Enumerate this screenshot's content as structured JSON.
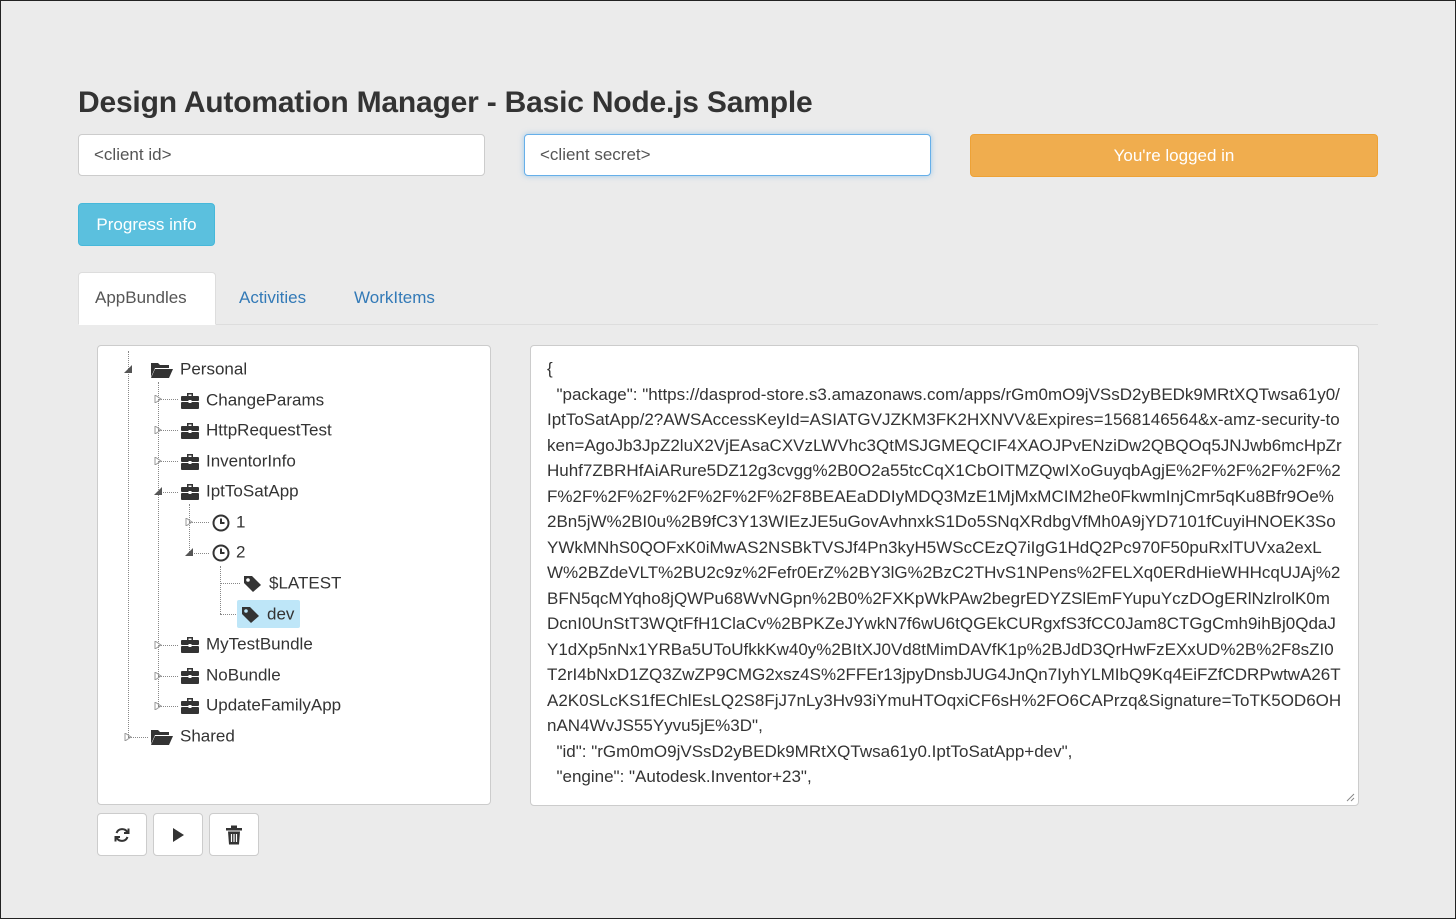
{
  "header": {
    "title": "Design Automation Manager - Basic Node.js Sample"
  },
  "login": {
    "client_id_value": "<client id>",
    "client_secret_value": "<client secret>",
    "status_button_label": "You're logged in"
  },
  "progress_button_label": "Progress info",
  "tabs": [
    {
      "label": "AppBundles",
      "active": true
    },
    {
      "label": "Activities",
      "active": false
    },
    {
      "label": "WorkItems",
      "active": false
    }
  ],
  "tree": {
    "personal": "Personal",
    "items": [
      "ChangeParams",
      "HttpRequestTest",
      "InventorInfo",
      "IptToSatApp",
      "MyTestBundle",
      "NoBundle",
      "UpdateFamilyApp"
    ],
    "versions": [
      "1",
      "2"
    ],
    "aliases": [
      "$LATEST",
      "dev"
    ],
    "shared": "Shared",
    "selected": "dev"
  },
  "details_json": "{\n  \"package\": \"https://dasprod-store.s3.amazonaws.com/apps/rGm0mO9jVSsD2yBEDk9MRtXQTwsa61y0/IptToSatApp/2?AWSAccessKeyId=ASIATGVJZKM3FK2HXNVV&Expires=1568146564&x-amz-security-token=AgoJb3JpZ2luX2VjEAsaCXVzLWVhc3QtMSJGMEQCIF4XAOJPvENziDw2QBQOq5JNJwb6mcHpZrHuhf7ZBRHfAiARure5DZ12g3cvgg%2B0O2a55tcCqX1CbOITMZQwIXoGuyqbAgjE%2F%2F%2F%2F%2F%2F%2F%2F%2F%2F%2F%2F8BEAEaDDIyMDQ3MzE1MjMxMCIM2he0FkwmInjCmr5qKu8Bfr9Oe%2Bn5jW%2BI0u%2B9fC3Y13WIEzJE5uGovAvhnxkS1Do5SNqXRdbgVfMh0A9jYD7101fCuyiHNOEK3SoYWkMNhS0QOFxK0iMwAS2NSBkTVSJf4Pn3kyH5WScCEzQ7iIgG1HdQ2Pc970F50puRxlTUVxa2exLW%2BZdeVLT%2BU2c9z%2Fefr0ErZ%2BY3lG%2BzC2THvS1NPens%2FELXq0ERdHieWHHcqUJAj%2BFN5qcMYqho8jQWPu68WvNGpn%2B0%2FXKpWkPAw2begrEDYZSlEmFYupuYczDOgERlNzlrolK0mDcnI0UnStT3WQtFfH1ClaCv%2BPKZeJYwkN7f6wU6tQGEkCURgxfS3fCC0Jam8CTGgCmh9ihBj0QdaJY1dXp5nNx1YRBa5UToUfkkKw40y%2BItXJ0Vd8tMimDAVfK1p%2BJdD3QrHwFzEXxUD%2B%2F8sZI0T2rI4bNxD1ZQ3ZwZP9CMG2xsz4S%2FFEr13jpyDnsbJUG4JnQn7IyhYLMIbQ9Kq4EiFZfCDRPwtwA26TA2K0SLcKS1fEChlEsLQ2S8FjJ7nLy3Hv93iYmuHTOqxiCF6sH%2FO6CAPrzq&Signature=ToTK5OD6OHnAN4WvJS55Yyvu5jE%3D\",\n  \"id\": \"rGm0mO9jVSsD2yBEDk9MRtXQTwsa61y0.IptToSatApp+dev\",\n  \"engine\": \"Autodesk.Inventor+23\",",
  "colors": {
    "warning": "#f0ad4e",
    "info": "#5bc0de",
    "link": "#337ab7",
    "selected_node": "#bee6f8"
  },
  "icons": {
    "folder": "folder-open-icon",
    "bundle": "briefcase-icon",
    "version": "clock-icon",
    "alias": "tag-icon",
    "refresh": "refresh-icon",
    "run": "play-icon",
    "delete": "trash-icon"
  }
}
